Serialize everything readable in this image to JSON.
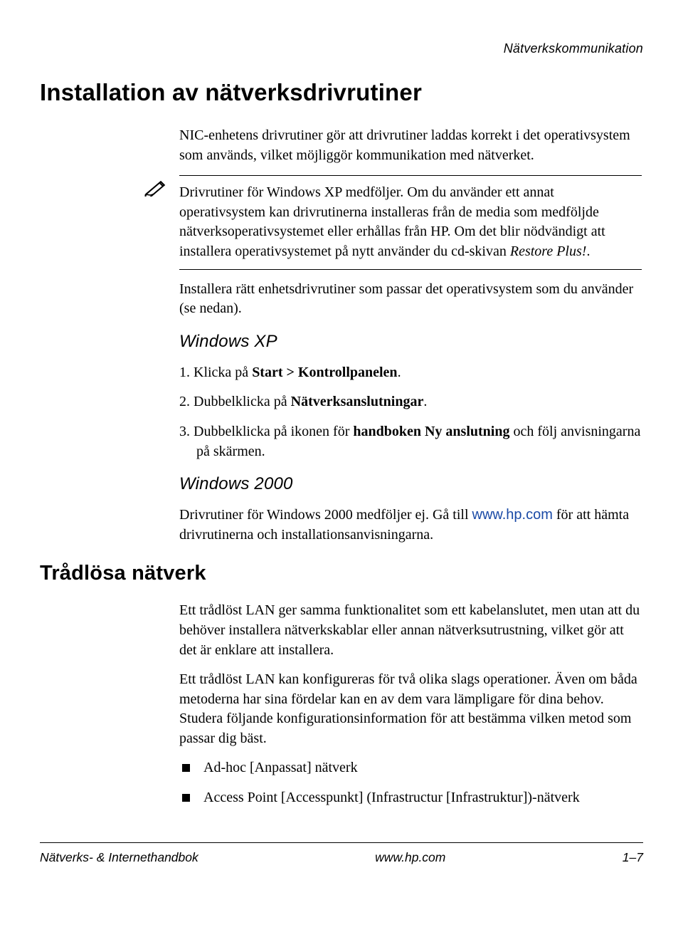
{
  "running_header": "Nätverkskommunikation",
  "h1": "Installation av nätverksdrivrutiner",
  "intro": "NIC-enhetens drivrutiner gör att drivrutiner laddas korrekt i det operativsystem som används, vilket möjliggör kommunikation med nätverket.",
  "note_part1": "Drivrutiner för Windows XP medföljer. Om du använder ett annat operativsystem kan drivrutinerna installeras från de media som medföljde nätverksoperativsystemet eller erhållas från HP. Om det blir nödvändigt att installera operativsystemet på nytt använder du cd-skivan ",
  "note_ital": "Restore Plus!",
  "note_part2": ".",
  "after_note": "Installera rätt enhetsdrivrutiner som passar det operativsystem som du använder (se nedan).",
  "xp_heading": "Windows XP",
  "xp_steps": {
    "s1_pre": "1. Klicka på ",
    "s1_bold": "Start > Kontrollpanelen",
    "s1_post": ".",
    "s2_pre": "2. Dubbelklicka på ",
    "s2_bold": "Nätverksanslutningar",
    "s2_post": ".",
    "s3_pre": "3. Dubbelklicka på ikonen för ",
    "s3_bold": "handboken Ny anslutning",
    "s3_post": " och följ anvisningarna på skärmen."
  },
  "w2000_heading": "Windows 2000",
  "w2000_pre": "Drivrutiner för Windows 2000 medföljer ej. Gå till ",
  "w2000_link": "www.hp.com",
  "w2000_post": " för att hämta drivrutinerna och installationsanvisningarna.",
  "h2": "Trådlösa nätverk",
  "wlan_p1": "Ett trådlöst LAN ger samma funktionalitet som ett kabelanslutet, men utan att du behöver installera nätverkskablar eller annan nätverksutrustning, vilket gör att det är enklare att installera.",
  "wlan_p2": "Ett trådlöst LAN kan konfigureras för två olika slags operationer. Även om båda metoderna har sina fördelar kan en av dem vara lämpligare för dina behov. Studera följande konfigurationsinformation för att bestämma vilken metod som passar dig bäst.",
  "bullets": {
    "b1": "Ad-hoc [Anpassat] nätverk",
    "b2": "Access Point [Accesspunkt] (Infrastructur [Infrastruktur])-nätverk"
  },
  "footer": {
    "left": "Nätverks- & Internethandbok",
    "center": "www.hp.com",
    "right": "1–7"
  }
}
